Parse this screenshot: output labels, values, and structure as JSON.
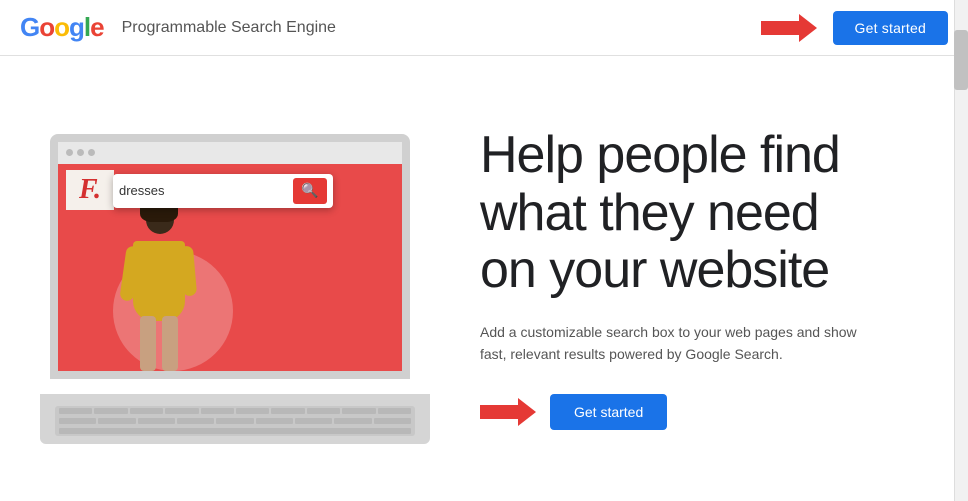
{
  "header": {
    "logo_letters": [
      {
        "char": "G",
        "color": "g-blue"
      },
      {
        "char": "o",
        "color": "g-red"
      },
      {
        "char": "o",
        "color": "g-yellow"
      },
      {
        "char": "g",
        "color": "g-blue"
      },
      {
        "char": "l",
        "color": "g-green"
      },
      {
        "char": "e",
        "color": "g-red"
      }
    ],
    "title": "Programmable Search Engine",
    "get_started_label": "Get started"
  },
  "hero": {
    "headline_line1": "Help people find",
    "headline_line2": "what they need",
    "headline_line3": "on your website",
    "subtext": "Add a customizable search box to your web pages and show fast, relevant results powered by Google Search.",
    "get_started_label": "Get started",
    "search_placeholder": "dresses",
    "search_icon": "🔍",
    "fashion_logo": "F."
  }
}
